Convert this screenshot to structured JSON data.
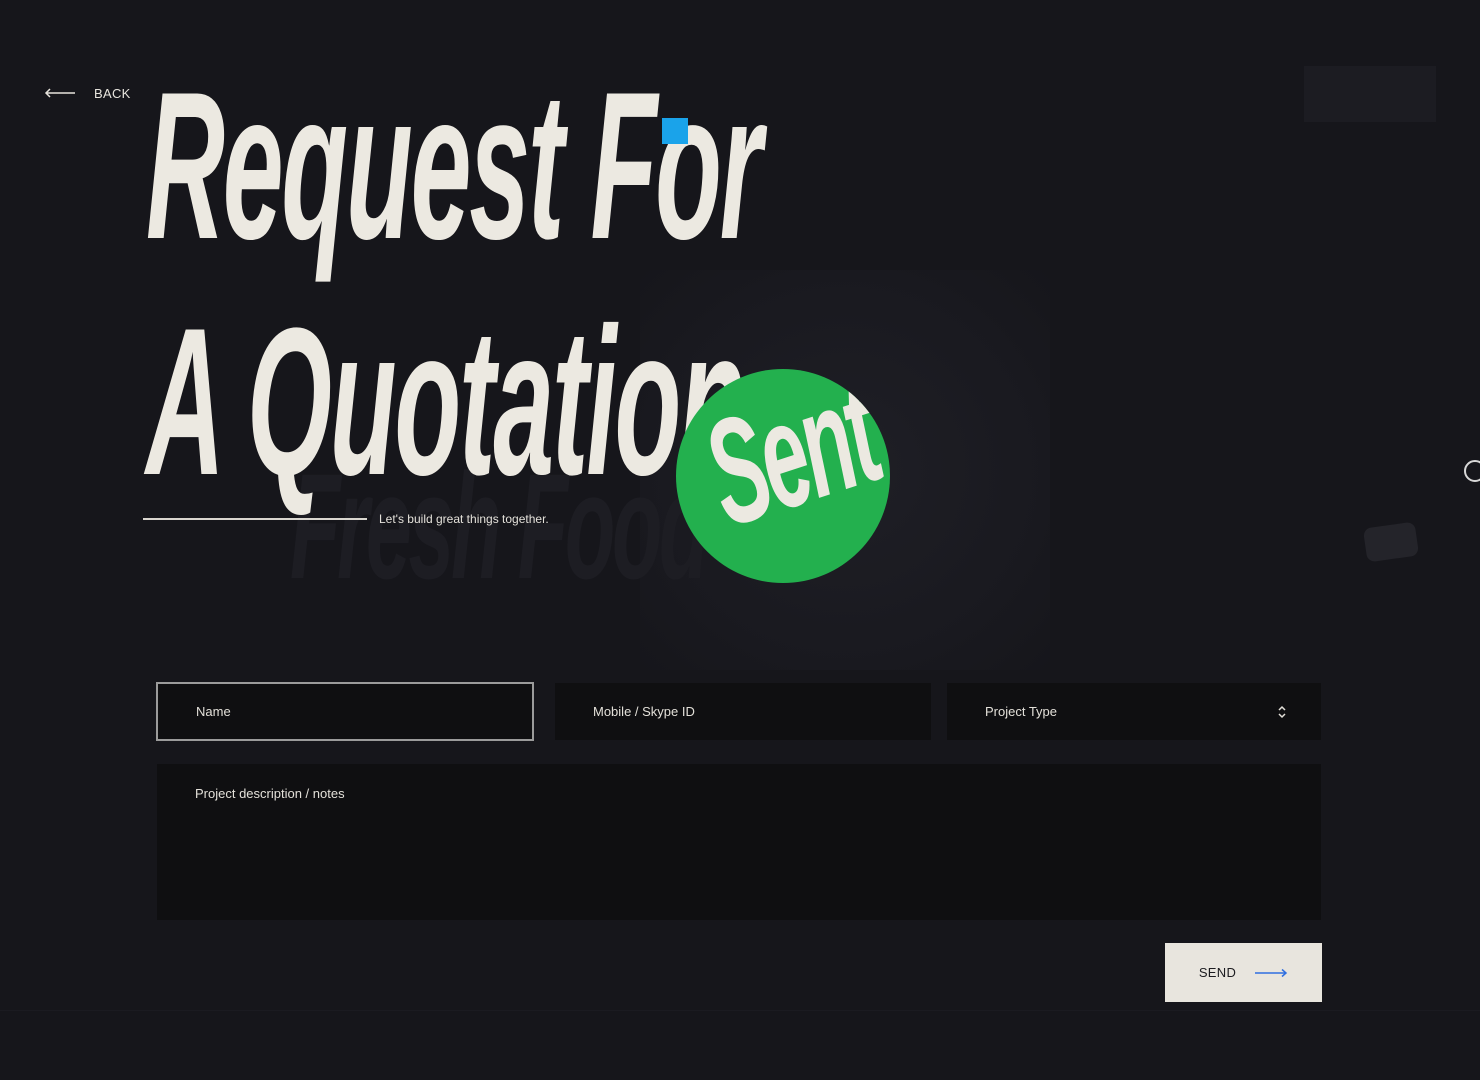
{
  "header": {
    "back_label": "BACK",
    "back_icon": "arrow-left-icon"
  },
  "hero": {
    "title_line1": "Request For",
    "title_line2": "A Quotation",
    "accent_color": "#1aa3ea",
    "badge_text": "Sent",
    "badge_color": "#23b04e",
    "tagline": "Let's build great things together."
  },
  "form": {
    "name_placeholder": "Name",
    "mobile_placeholder": "Mobile / Skype ID",
    "project_type_label": "Project Type",
    "project_type_icon": "sort-updown-icon",
    "notes_placeholder": "Project description / notes",
    "send_label": "SEND",
    "send_icon": "arrow-right-icon",
    "send_arrow_color": "#2f6fe0"
  },
  "background": {
    "ghost_text": "Fresh Food"
  }
}
